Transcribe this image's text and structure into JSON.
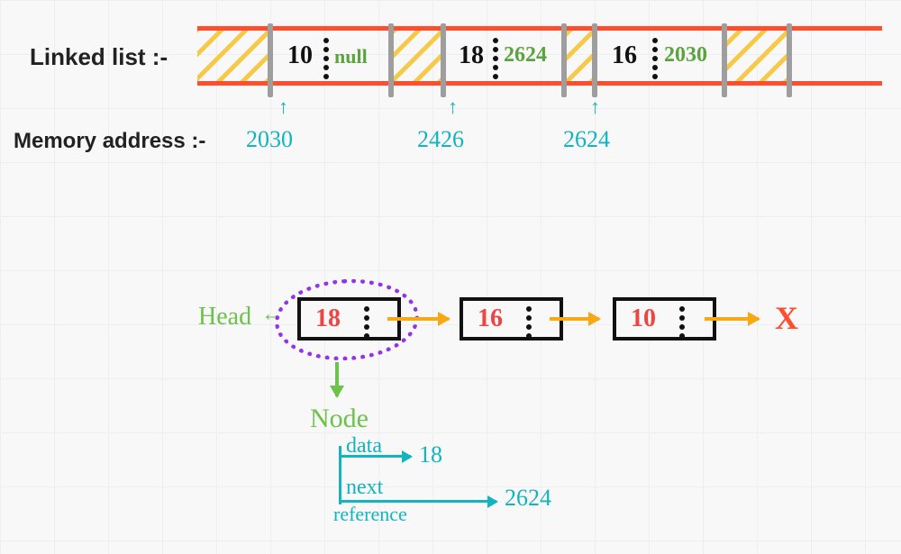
{
  "labels": {
    "linked_list": "Linked list :-",
    "memory_address": "Memory address :-",
    "head": "Head",
    "node": "Node",
    "data": "data",
    "next": "next",
    "reference": "reference",
    "null_term": "X"
  },
  "memory": {
    "cells": [
      {
        "value": "10",
        "next": "null",
        "address": "2030"
      },
      {
        "value": "18",
        "next": "2624",
        "address": "2426"
      },
      {
        "value": "16",
        "next": "2030",
        "address": "2624"
      }
    ]
  },
  "list": {
    "nodes": [
      {
        "value": "18"
      },
      {
        "value": "16"
      },
      {
        "value": "10"
      }
    ]
  },
  "node_detail": {
    "data_value": "18",
    "next_value": "2624"
  }
}
